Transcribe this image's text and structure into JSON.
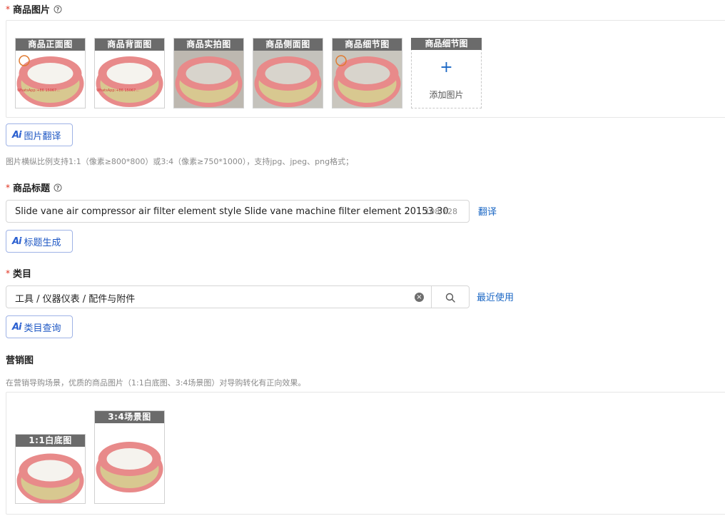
{
  "product_images": {
    "label": "商品图片",
    "required_mark": "*",
    "help_icon": "question-circle-icon",
    "thumbs": [
      {
        "caption": "商品正面图",
        "watermark": "WhatsApp:+86 15067...",
        "has_badge": true,
        "bg": "#ffffff"
      },
      {
        "caption": "商品背面图",
        "watermark": "WhatsApp:+86 15067...",
        "has_badge": false,
        "bg": "#ffffff"
      },
      {
        "caption": "商品实拍图",
        "watermark": "",
        "has_badge": false,
        "bg": "#bdb8b0"
      },
      {
        "caption": "商品侧面图",
        "watermark": "",
        "has_badge": false,
        "bg": "#c4c2bc"
      },
      {
        "caption": "商品细节图",
        "watermark": "",
        "has_badge": true,
        "bg": "#c9c6be"
      }
    ],
    "add_tile": {
      "caption": "商品细节图",
      "plus": "+",
      "text": "添加图片"
    },
    "ai_button": {
      "mark": "Ai",
      "label": "图片翻译"
    },
    "hint": "图片横纵比例支持1:1（像素≥800*800）或3:4（像素≥750*1000），支持jpg、jpeg、png格式；"
  },
  "title": {
    "label": "商品标题",
    "required_mark": "*",
    "help_icon": "question-circle-icon",
    "value": "Slide vane air compressor air filter element style Slide vane machine filter element 20153 30",
    "counter": "108/128",
    "translate_link": "翻译",
    "ai_button": {
      "mark": "Ai",
      "label": "标题生成"
    }
  },
  "category": {
    "label": "类目",
    "required_mark": "*",
    "value": "工具 / 仪器仪表 / 配件与附件",
    "clear_icon": "clear-circle-icon",
    "search_icon": "search-icon",
    "recent_link": "最近使用",
    "ai_button": {
      "mark": "Ai",
      "label": "类目查询"
    }
  },
  "marketing": {
    "label": "营销图",
    "hint": "在营销导购场景，优质的商品图片（1:1白底图、3:4场景图）对导购转化有正向效果。",
    "thumbs": [
      {
        "caption": "1:1白底图"
      },
      {
        "caption": "3:4场景图"
      }
    ]
  },
  "colors": {
    "accent": "#1966c4",
    "required": "#e0301e",
    "filter_ring": "#e88a8a",
    "filter_pleat": "#d8c890"
  }
}
